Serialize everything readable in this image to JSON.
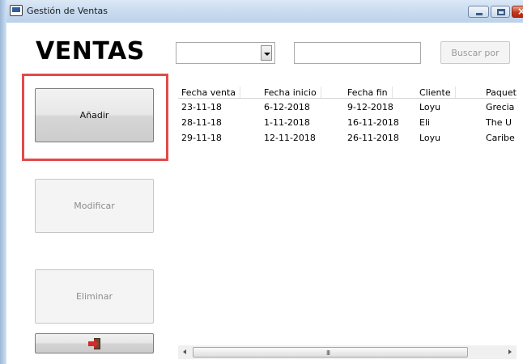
{
  "window": {
    "title": "Gestión de Ventas",
    "icon": "monitor-icon"
  },
  "heading": "VENTAS",
  "search": {
    "combo_value": "",
    "input_value": "",
    "button_label": "Buscar por"
  },
  "actions": {
    "add_label": "Añadir",
    "modify_label": "Modificar",
    "delete_label": "Eliminar",
    "exit_icon": "exit-door-icon"
  },
  "highlight_color": "#e24a4a",
  "table": {
    "columns": [
      "Fecha venta",
      "Fecha inicio",
      "Fecha fin",
      "Cliente",
      "Paquete"
    ],
    "rows": [
      [
        "23-11-18",
        "6-12-2018",
        "9-12-2018",
        "Loyu",
        "Grecia"
      ],
      [
        "28-11-18",
        "1-11-2018",
        "16-11-2018",
        "Eli",
        "The U"
      ],
      [
        "29-11-18",
        "12-11-2018",
        "26-11-2018",
        "Loyu",
        "Caribe"
      ]
    ]
  },
  "scrollbar": {
    "grip": "III"
  }
}
